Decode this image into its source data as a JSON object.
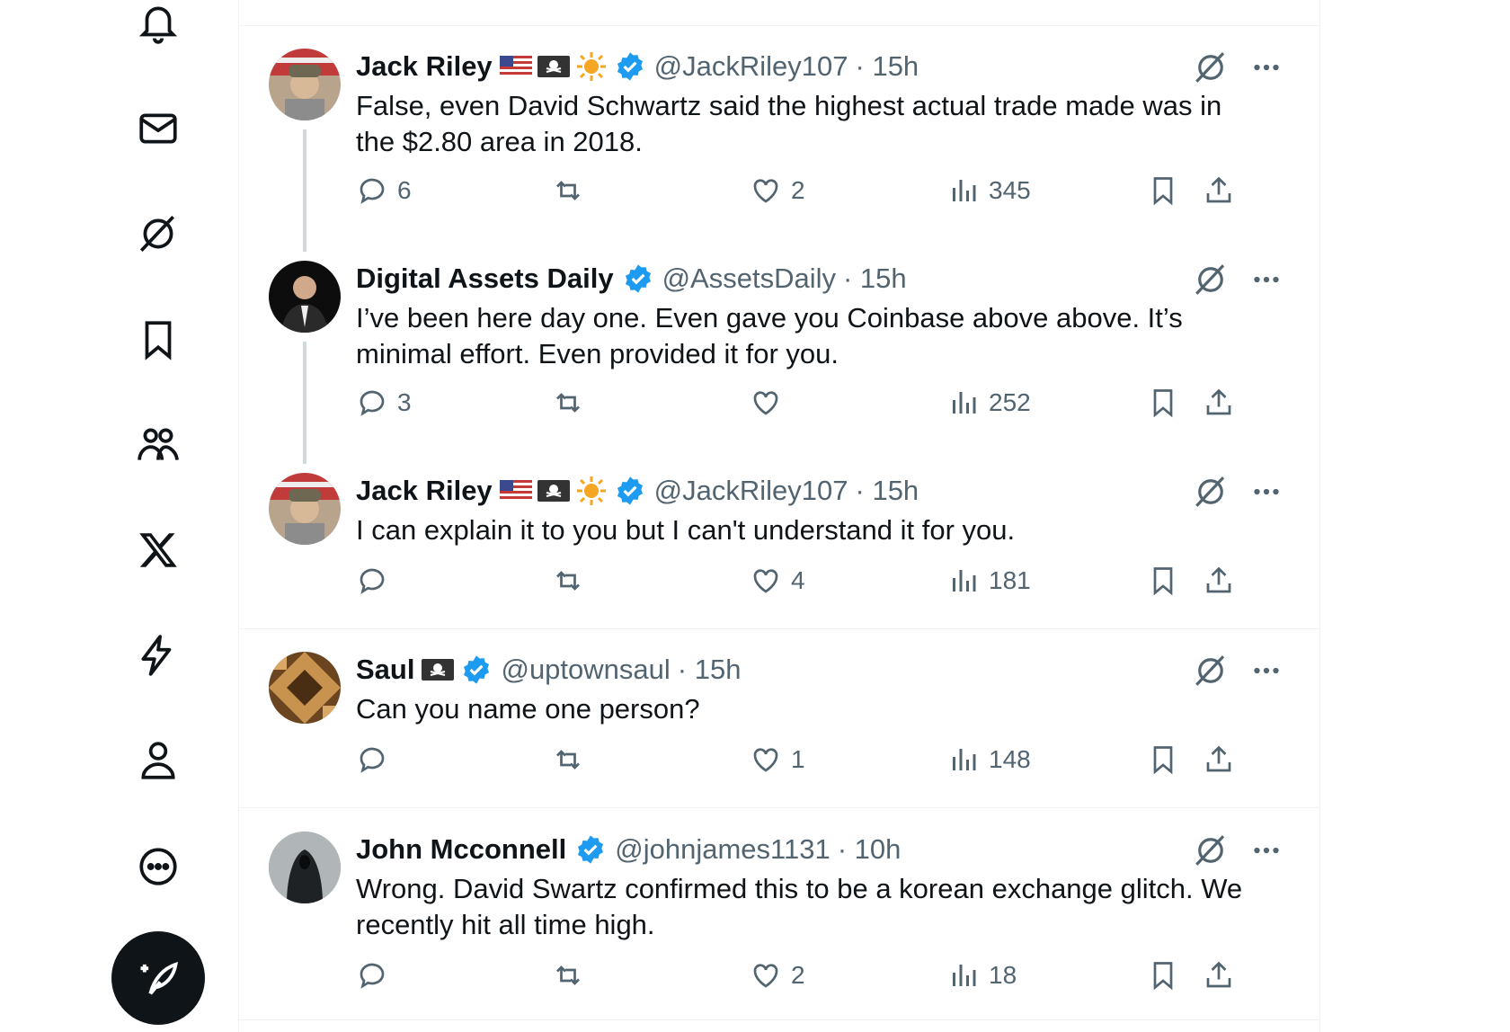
{
  "nav": {
    "items": [
      "notifications-icon",
      "messages-icon",
      "grok-icon",
      "bookmarks-icon",
      "communities-icon",
      "x-premium-icon",
      "verified-orgs-icon",
      "profile-icon",
      "more-icon"
    ],
    "compose": "post-compose-icon"
  },
  "tweets": [
    {
      "name": "Jack Riley",
      "handle": "@JackRiley107",
      "time": "· 15h",
      "text": "False, even David Schwartz said the highest actual trade made was in the $2.80 area in 2018.",
      "replies": "6",
      "retweets": "",
      "likes": "2",
      "views": "345",
      "badges": [
        "us-flag",
        "pirate-flag",
        "sun"
      ]
    },
    {
      "name": "Digital Assets Daily",
      "handle": "@AssetsDaily",
      "time": "· 15h",
      "text": "I’ve been here day one. Even gave you Coinbase above above. It’s minimal effort. Even provided it for you.",
      "replies": "3",
      "retweets": "",
      "likes": "",
      "views": "252",
      "badges": []
    },
    {
      "name": "Jack Riley",
      "handle": "@JackRiley107",
      "time": "· 15h",
      "text": "I can explain it to you but I can't understand it for you.",
      "replies": "",
      "retweets": "",
      "likes": "4",
      "views": "181",
      "badges": [
        "us-flag",
        "pirate-flag",
        "sun"
      ]
    },
    {
      "name": "Saul",
      "handle": "@uptownsaul",
      "time": "· 15h",
      "text": "Can you name one person?",
      "replies": "",
      "retweets": "",
      "likes": "1",
      "views": "148",
      "badges": [
        "pirate-flag"
      ]
    },
    {
      "name": "John Mcconnell",
      "handle": "@johnjames1131",
      "time": "· 10h",
      "text": "Wrong. David Swartz confirmed this to be a korean exchange glitch. We recently hit all time high.",
      "replies": "",
      "retweets": "",
      "likes": "2",
      "views": "18",
      "badges": []
    }
  ],
  "colors": {
    "verified": "#1d9bf0",
    "secondary": "#536471",
    "thread": "#cfd9de"
  }
}
